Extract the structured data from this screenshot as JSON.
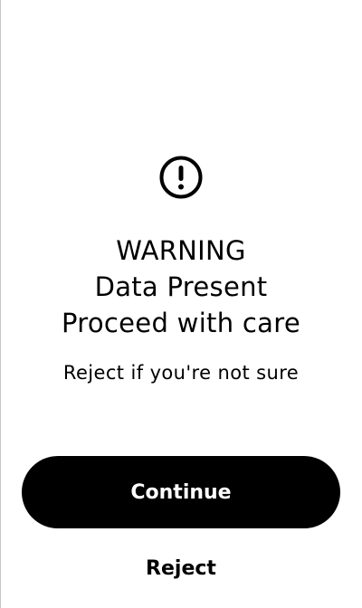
{
  "icon": {
    "name": "exclamation-circle-icon",
    "color": "#000000"
  },
  "headline": {
    "line1": "WARNING",
    "line2": "Data Present",
    "line3": "Proceed with care"
  },
  "subtext": "Reject if you're not sure",
  "actions": {
    "primary_label": "Continue",
    "primary_bg": "#000000",
    "primary_fg": "#ffffff",
    "secondary_label": "Reject"
  }
}
